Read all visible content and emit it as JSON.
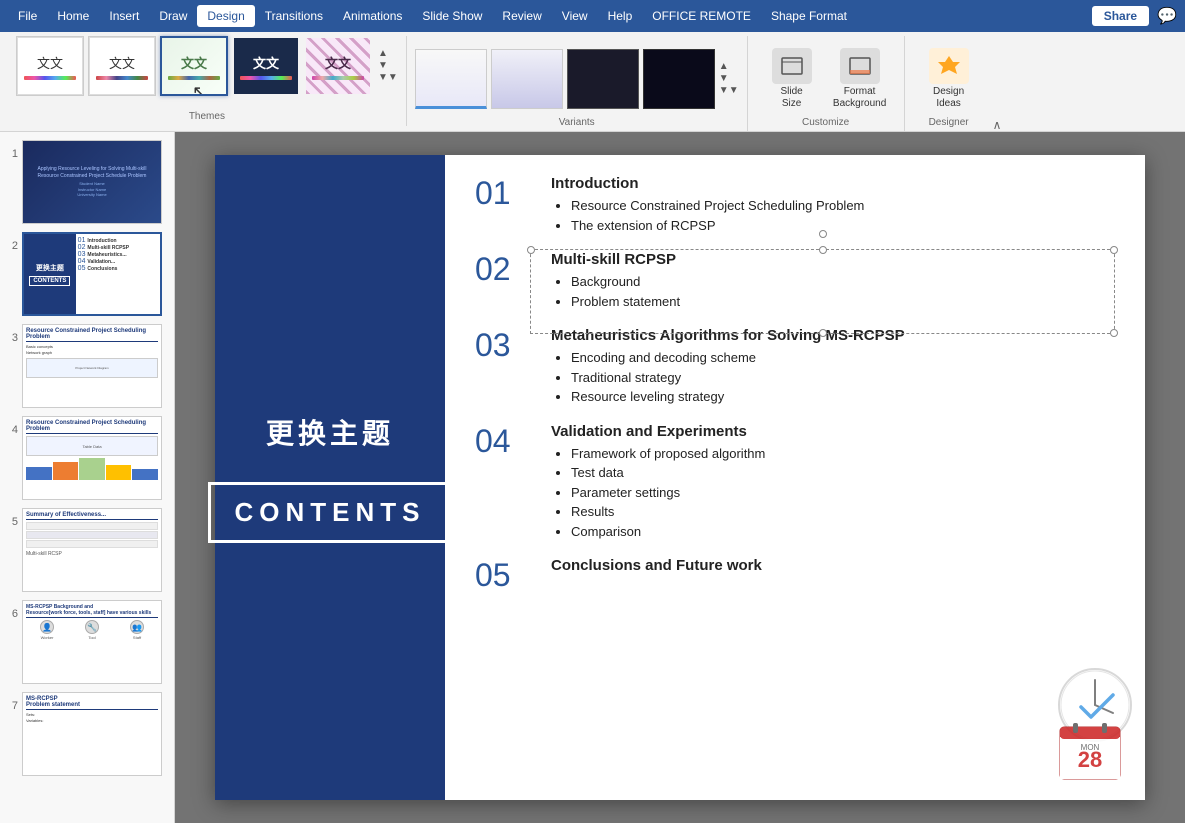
{
  "menubar": {
    "items": [
      "File",
      "Home",
      "Insert",
      "Draw",
      "Design",
      "Transitions",
      "Animations",
      "Slide Show",
      "Review",
      "View",
      "Help",
      "OFFICE REMOTE",
      "Shape Format"
    ],
    "active": "Design",
    "share_label": "Share",
    "comment_icon": "💬"
  },
  "ribbon": {
    "themes_label": "Themes",
    "themes": [
      {
        "id": "t1",
        "label": "文文",
        "type": "plain"
      },
      {
        "id": "t2",
        "label": "文文",
        "type": "plain2"
      },
      {
        "id": "t3",
        "label": "文文",
        "type": "green",
        "active": true
      },
      {
        "id": "t4",
        "label": "文文",
        "type": "dark"
      },
      {
        "id": "t5",
        "label": "文文",
        "type": "pattern"
      }
    ],
    "variants_label": "Variants",
    "customize_label": "Customize",
    "designer_label": "Designer",
    "slide_size_label": "Slide\nSize",
    "format_background_label": "Format\nBackground",
    "design_ideas_label": "Design\nIdeas"
  },
  "slides": [
    {
      "num": "1",
      "active": false
    },
    {
      "num": "2",
      "active": true
    },
    {
      "num": "3",
      "active": false
    },
    {
      "num": "4",
      "active": false
    },
    {
      "num": "5",
      "active": false
    },
    {
      "num": "6",
      "active": false
    },
    {
      "num": "7",
      "active": false
    }
  ],
  "slide": {
    "title_cn": "更换主题",
    "contents_label": "CONTENTS",
    "items": [
      {
        "num": "01",
        "heading": "Introduction",
        "bullets": [
          "Resource Constrained Project Scheduling Problem",
          "The extension of RCPSP"
        ]
      },
      {
        "num": "02",
        "heading": "Multi-skill RCPSP",
        "bullets": [
          "Background",
          "Problem statement"
        ]
      },
      {
        "num": "03",
        "heading": "Metaheuristics Algorithms for Solving MS-RCPSP",
        "bullets": [
          "Encoding and decoding scheme",
          "Traditional strategy",
          "Resource leveling strategy"
        ]
      },
      {
        "num": "04",
        "heading": "Validation and Experiments",
        "bullets": [
          "Framework of proposed algorithm",
          "Test data",
          "Parameter settings",
          "Results",
          "Comparison"
        ]
      },
      {
        "num": "05",
        "heading": "Conclusions and Future work",
        "bullets": []
      }
    ]
  }
}
